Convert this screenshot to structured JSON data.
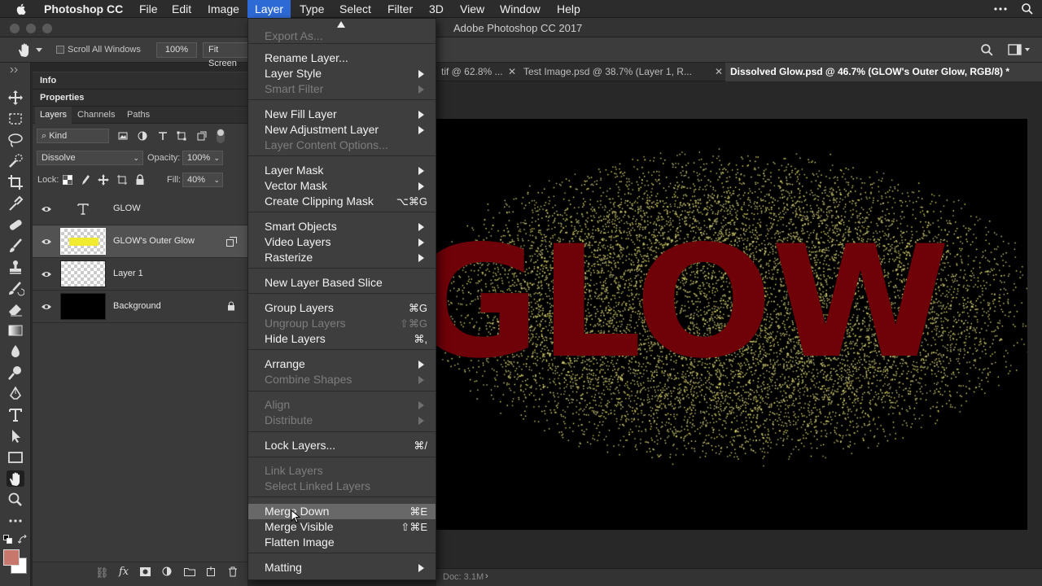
{
  "menubar": {
    "app": "Photoshop CC",
    "items": [
      "File",
      "Edit",
      "Image",
      "Layer",
      "Type",
      "Select",
      "Filter",
      "3D",
      "View",
      "Window",
      "Help"
    ]
  },
  "window": {
    "title": "Adobe Photoshop CC 2017"
  },
  "options": {
    "scroll_all": "Scroll All Windows",
    "zoom": "100%",
    "fit_screen": "Fit Screen"
  },
  "panels": {
    "info": "Info",
    "properties": "Properties",
    "tabs": [
      "Layers",
      "Channels",
      "Paths"
    ],
    "kind": "Kind",
    "blend_mode": "Dissolve",
    "opacity_label": "Opacity:",
    "opacity": "100%",
    "lock_label": "Lock:",
    "fill_label": "Fill:",
    "fill": "40%",
    "layers": [
      {
        "name": "GLOW",
        "kind": "text"
      },
      {
        "name": "GLOW's Outer Glow",
        "kind": "glow",
        "selected": true
      },
      {
        "name": "Layer 1",
        "kind": "transparent"
      },
      {
        "name": "Background",
        "kind": "black",
        "locked": true
      }
    ]
  },
  "document": {
    "tabs": [
      "tif @ 62.8% ...",
      "Test Image.psd @ 38.7% (Layer 1, R...",
      "Dissolved Glow.psd @ 46.7% (GLOW's Outer Glow, RGB/8) *"
    ],
    "canvas_text": "GLOW",
    "status": "Doc: 3.1M"
  },
  "layer_menu": {
    "items": [
      {
        "label": "Export As...",
        "shortcut": "",
        "disabled": true
      },
      {
        "label": "Rename Layer...",
        "shortcut": ""
      },
      {
        "label": "Layer Style",
        "submenu": true
      },
      {
        "label": "Smart Filter",
        "submenu": true,
        "disabled": true
      },
      {
        "label": "New Fill Layer",
        "submenu": true
      },
      {
        "label": "New Adjustment Layer",
        "submenu": true
      },
      {
        "label": "Layer Content Options...",
        "disabled": true
      },
      {
        "label": "Layer Mask",
        "submenu": true
      },
      {
        "label": "Vector Mask",
        "submenu": true
      },
      {
        "label": "Create Clipping Mask",
        "shortcut": "⌥⌘G"
      },
      {
        "label": "Smart Objects",
        "submenu": true
      },
      {
        "label": "Video Layers",
        "submenu": true
      },
      {
        "label": "Rasterize",
        "submenu": true
      },
      {
        "label": "New Layer Based Slice"
      },
      {
        "label": "Group Layers",
        "shortcut": "⌘G"
      },
      {
        "label": "Ungroup Layers",
        "shortcut": "⇧⌘G",
        "disabled": true
      },
      {
        "label": "Hide Layers",
        "shortcut": "⌘,"
      },
      {
        "label": "Arrange",
        "submenu": true
      },
      {
        "label": "Combine Shapes",
        "submenu": true,
        "disabled": true
      },
      {
        "label": "Align",
        "submenu": true,
        "disabled": true
      },
      {
        "label": "Distribute",
        "submenu": true,
        "disabled": true
      },
      {
        "label": "Lock Layers...",
        "shortcut": "⌘/"
      },
      {
        "label": "Link Layers",
        "disabled": true
      },
      {
        "label": "Select Linked Layers",
        "disabled": true
      },
      {
        "label": "Merge Down",
        "shortcut": "⌘E",
        "highlighted": true
      },
      {
        "label": "Merge Visible",
        "shortcut": "⇧⌘E"
      },
      {
        "label": "Flatten Image"
      },
      {
        "label": "Matting",
        "submenu": true
      }
    ]
  },
  "colors": {
    "menu_active": "#2e6ad6",
    "glow_text": "#6e0208",
    "glow_speckle": "#d7d27a",
    "foreground": "#c8776c",
    "background": "#ffffff"
  }
}
